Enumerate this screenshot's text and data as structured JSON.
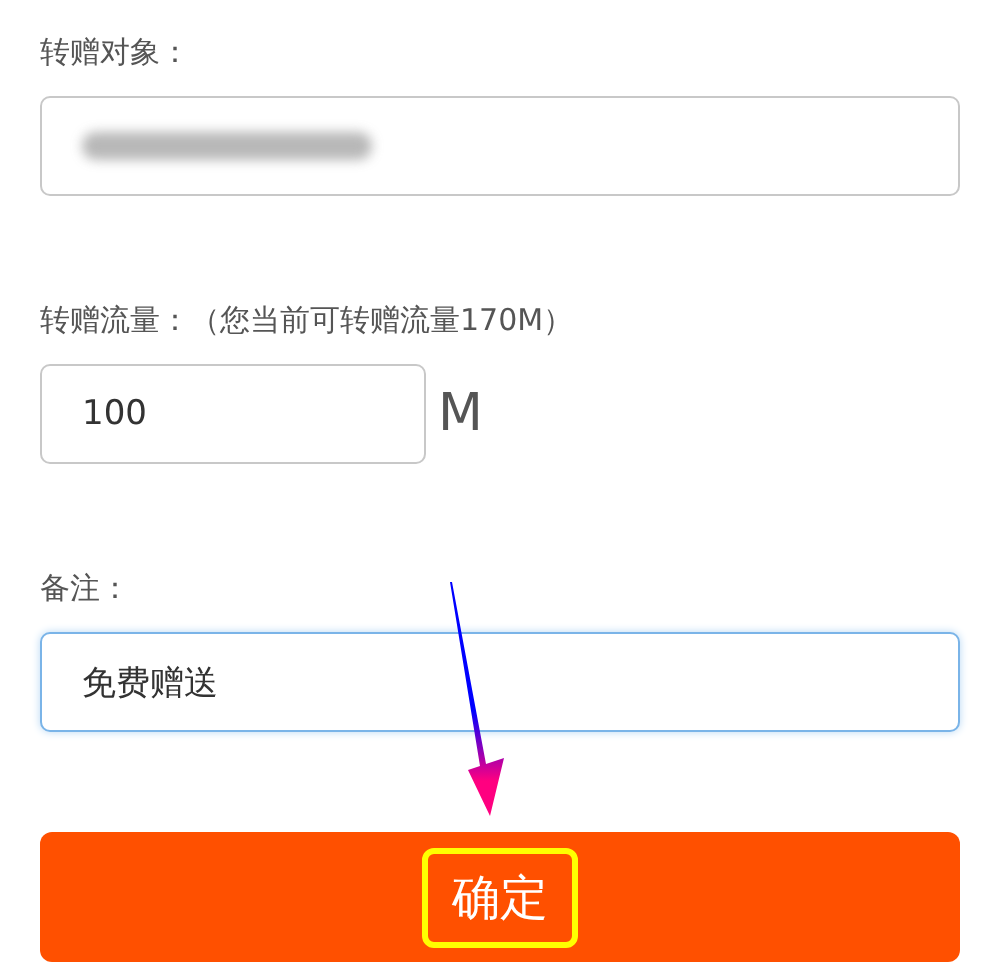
{
  "fields": [
    {
      "label": "转赠对象：",
      "kind": "redacted",
      "focused": false
    },
    {
      "label": "转赠流量：（您当前可转赠流量170M）",
      "kind": "unit",
      "value": "100",
      "unit": "M",
      "focused": false
    },
    {
      "label": "备注：",
      "kind": "text",
      "value": "免费赠送",
      "focused": true
    }
  ],
  "submit": {
    "label": "确定",
    "highlighted": true
  },
  "annotation": {
    "kind": "arrow"
  }
}
